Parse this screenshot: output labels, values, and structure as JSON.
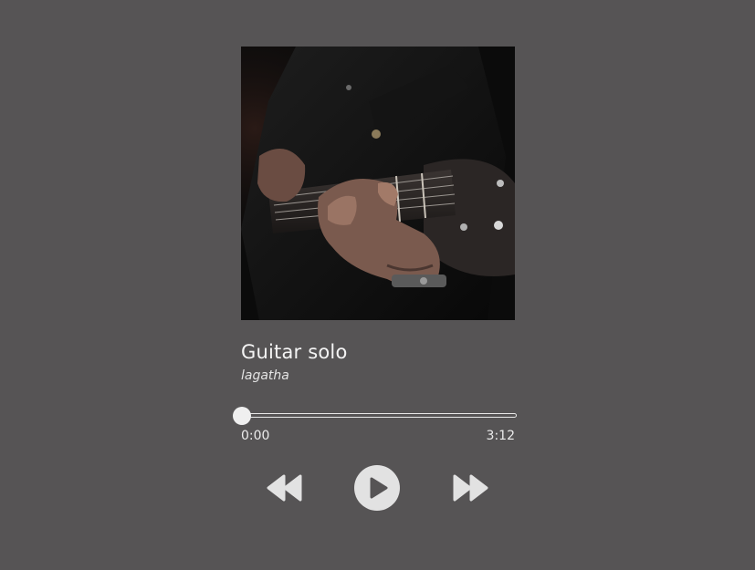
{
  "track": {
    "title": "Guitar solo",
    "artist": "lagatha",
    "current_time": "0:00",
    "duration": "3:12",
    "progress": 0
  },
  "cover": {
    "subject": "guitarist-playing-electric-guitar-photo"
  },
  "controls": {
    "previous_icon": "rewind-icon",
    "play_icon": "play-icon",
    "next_icon": "fast-forward-icon"
  },
  "colors": {
    "background": "#565455",
    "foreground": "#efefef"
  }
}
